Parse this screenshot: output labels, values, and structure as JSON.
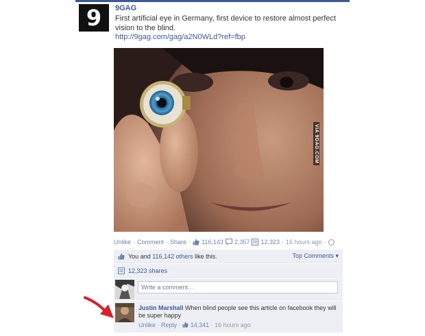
{
  "post": {
    "page_name": "9GAG",
    "logo_glyph": "9",
    "text": "First artificial eye in Germany, first device to restore almost perfect vision to the blind.",
    "link": "http://9gag.com/gag/a2N0WLd?ref=fbp",
    "photo_watermark": "VIA 9GAG.COM"
  },
  "actions": {
    "unlike": "Unlike",
    "comment": "Comment",
    "share": "Share",
    "like_count": "116,143",
    "comment_count": "2,357",
    "share_count": "12,323",
    "time": "16 hours ago"
  },
  "likes_row": {
    "you": "You",
    "and": " and ",
    "others": "116,142 others",
    "like_this": " like this.",
    "top_comments": "Top Comments ▾"
  },
  "shares_row": {
    "text": "12,323 shares"
  },
  "comment_box": {
    "placeholder": "Write a comment..."
  },
  "comment": {
    "author": "Justin Marshall",
    "text": "When blind people see this article on facebook they will be super happy",
    "unlike": "Unlike",
    "reply": "Reply",
    "likes": "14,341",
    "time": "16 hours ago"
  },
  "colors": {
    "facebook_blue": "#3b5998",
    "link_blue": "#6d84b4",
    "ufi_background": "#edeff4",
    "annotation_red": "#d8202c"
  },
  "icons": [
    "thumbs-up-icon",
    "comment-bubble-icon",
    "share-icon",
    "globe-icon",
    "red-arrow-annotation"
  ]
}
